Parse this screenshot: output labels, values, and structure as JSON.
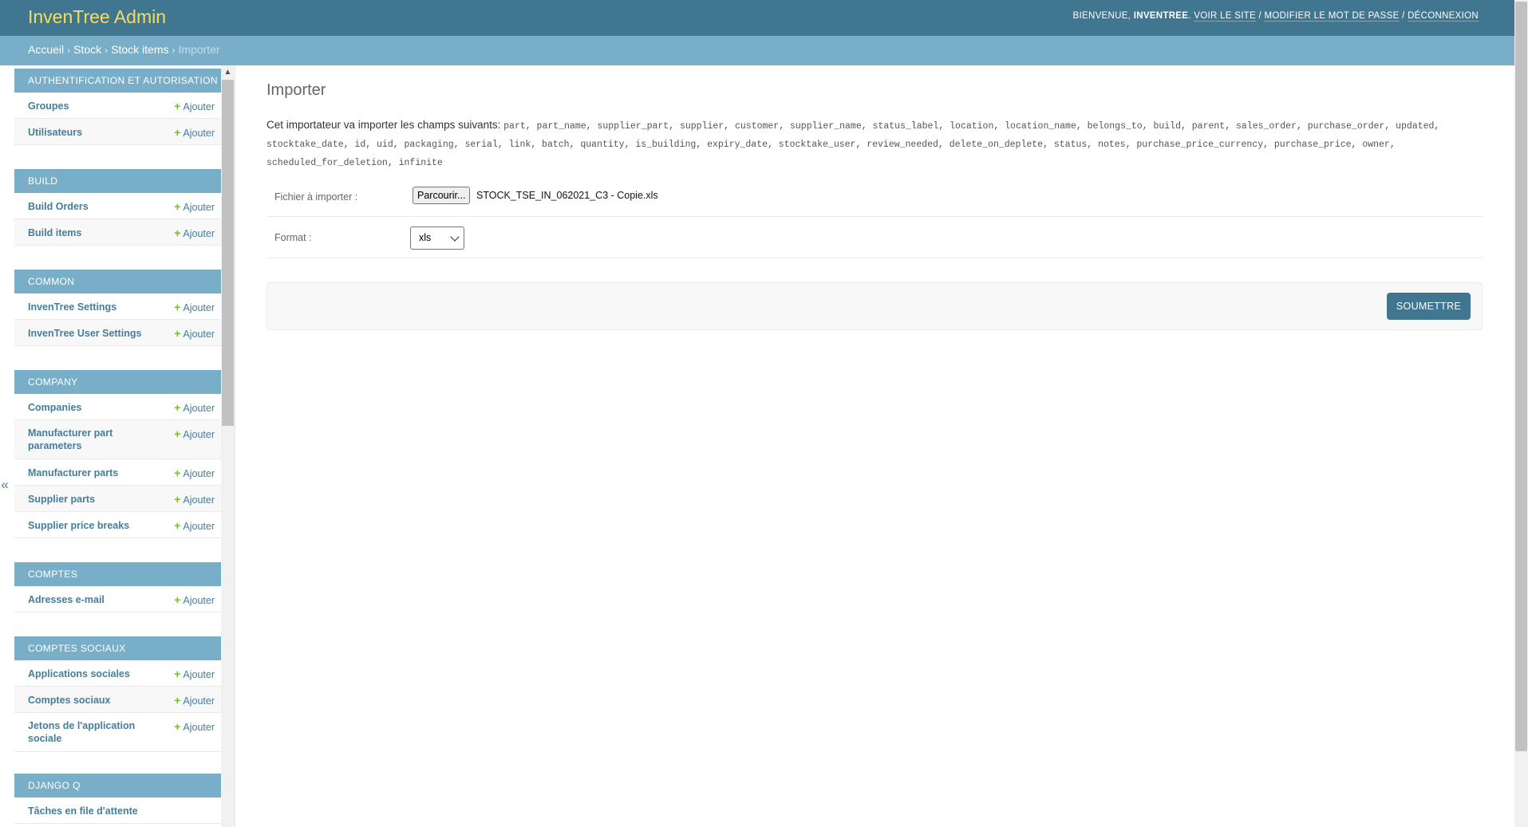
{
  "header": {
    "branding": "InvenTree Admin",
    "welcome": "BIENVENUE,",
    "username": "INVENTREE",
    "view_site": "VOIR LE SITE",
    "change_password": "MODIFIER LE MOT DE PASSE",
    "logout": "DÉCONNEXION",
    "separator": "/"
  },
  "breadcrumbs": {
    "items": [
      "Accueil",
      "Stock",
      "Stock items"
    ],
    "current": "Importer",
    "separator": "›"
  },
  "sidebar": {
    "toggle": "«",
    "add_label": "Ajouter",
    "modules": [
      {
        "caption": "AUTHENTIFICATION ET AUTORISATION",
        "models": [
          {
            "name": "Groupes",
            "add": true
          },
          {
            "name": "Utilisateurs",
            "add": true
          }
        ]
      },
      {
        "caption": "BUILD",
        "models": [
          {
            "name": "Build Orders",
            "add": true
          },
          {
            "name": "Build items",
            "add": true
          }
        ]
      },
      {
        "caption": "COMMON",
        "models": [
          {
            "name": "InvenTree Settings",
            "add": true
          },
          {
            "name": "InvenTree User Settings",
            "add": true
          }
        ]
      },
      {
        "caption": "COMPANY",
        "models": [
          {
            "name": "Companies",
            "add": true
          },
          {
            "name": "Manufacturer part parameters",
            "add": true
          },
          {
            "name": "Manufacturer parts",
            "add": true
          },
          {
            "name": "Supplier parts",
            "add": true
          },
          {
            "name": "Supplier price breaks",
            "add": true
          }
        ]
      },
      {
        "caption": "COMPTES",
        "models": [
          {
            "name": "Adresses e-mail",
            "add": true
          }
        ]
      },
      {
        "caption": "COMPTES SOCIAUX",
        "models": [
          {
            "name": "Applications sociales",
            "add": true
          },
          {
            "name": "Comptes sociaux",
            "add": true
          },
          {
            "name": "Jetons de l'application sociale",
            "add": true
          }
        ]
      },
      {
        "caption": "DJANGO Q",
        "models": [
          {
            "name": "Tâches en file d'attente",
            "add": false
          }
        ]
      }
    ]
  },
  "main": {
    "title": "Importer",
    "intro_text": "Cet importateur va importer les champs suivants:",
    "fields_line1": "part, part_name, supplier_part, supplier, customer, supplier_name, status_label, location, location_name, belongs_to, build, parent, sales_order, purchase_order, updated,",
    "fields_line2": "stocktake_date, id, uid, packaging, serial, link, batch, quantity, is_building, expiry_date, stocktake_user, review_needed, delete_on_deplete, status, notes, purchase_price_currency, purchase_price, owner,",
    "fields_line3": "scheduled_for_deletion, infinite",
    "file_label": "Fichier à importer :",
    "browse_button": "Parcourir...",
    "file_name": "STOCK_TSE_IN_062021_C3 - Copie.xls",
    "format_label": "Format :",
    "format_value": "xls",
    "submit": "SOUMETTRE"
  },
  "colors": {
    "header": "#417690",
    "branding": "#f5dd5d",
    "breadcrumbs": "#79aec8",
    "link": "#447e9b",
    "add_icon": "#70bf2b"
  }
}
